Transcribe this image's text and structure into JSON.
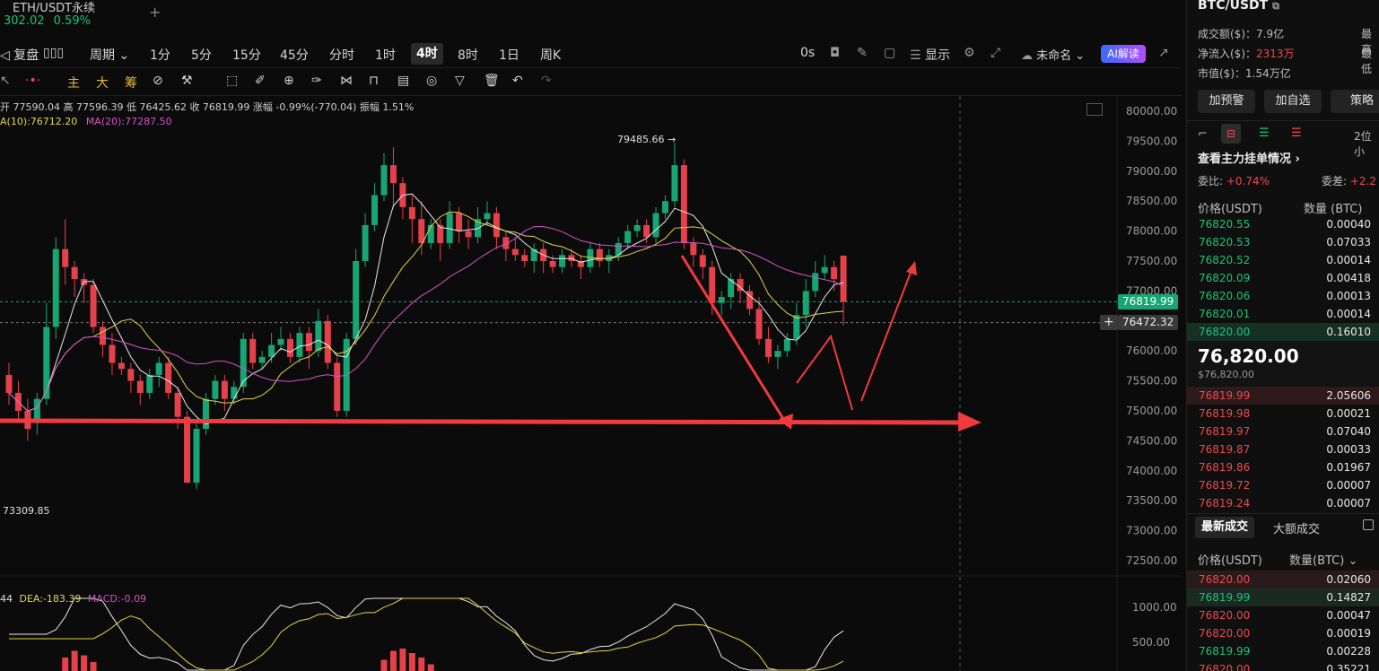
{
  "header": {
    "pair": "ETH/USDT永续",
    "price_partial": "302.02",
    "change": "0.59%",
    "add_tab": "+"
  },
  "toolbar": {
    "replay": "复盘",
    "period_label": "周期",
    "intervals": [
      "1分",
      "5分",
      "15分",
      "45分",
      "分时",
      "1时",
      "4时",
      "8时",
      "1日",
      "周K"
    ],
    "active_interval": "4时",
    "countdown": "0s",
    "display": "显示",
    "layout_name": "未命名",
    "ai_button": "AI解读"
  },
  "toolbar2": {
    "main": "主",
    "big": "大",
    "chip": "筹"
  },
  "chart_info": {
    "ohlc_line": "开 77590.04  高 77596.39  低 76425.62  收 76819.99  涨幅 -0.99%(-770.04)  振幅 1.51%",
    "ma10": "A(10):76712.20",
    "ma20": "MA(20):77287.50",
    "high_label": "79485.66 →",
    "low_label": "73309.85",
    "macd_dif": "44",
    "macd_dea": "DEA:-183.39",
    "macd_val": "MACD:-0.09"
  },
  "chart_data": {
    "type": "candlestick",
    "y_axis_ticks": [
      "80000.00",
      "79500.00",
      "79000.00",
      "78500.00",
      "78000.00",
      "77500.00",
      "77000.00",
      "76500.00",
      "76000.00",
      "75500.00",
      "75000.00",
      "74500.00",
      "74000.00",
      "73500.00",
      "73000.00",
      "72500.00"
    ],
    "macd_axis_ticks": [
      "1000.00",
      "500.00"
    ],
    "ylim": [
      72500,
      80000
    ],
    "last_price": "76819.99",
    "crosshair_price": "76472.32",
    "candles": [
      [
        75600,
        75300,
        75800,
        75100
      ],
      [
        75300,
        75000,
        75500,
        74800
      ],
      [
        75000,
        74700,
        75200,
        74500
      ],
      [
        74800,
        75200,
        75300,
        74600
      ],
      [
        75200,
        76400,
        76800,
        75100
      ],
      [
        76400,
        77700,
        77900,
        76200
      ],
      [
        77700,
        77400,
        78200,
        77100
      ],
      [
        77400,
        77200,
        77500,
        76900
      ],
      [
        77200,
        77100,
        77300,
        76800
      ],
      [
        77100,
        76400,
        77200,
        76300
      ],
      [
        76400,
        76100,
        76500,
        75900
      ],
      [
        76100,
        75800,
        76300,
        75600
      ],
      [
        75800,
        75700,
        75900,
        75600
      ],
      [
        75700,
        75500,
        75800,
        75300
      ],
      [
        75500,
        75300,
        75600,
        75100
      ],
      [
        75300,
        75600,
        75700,
        75200
      ],
      [
        75600,
        75800,
        75900,
        75400
      ],
      [
        75800,
        75300,
        75900,
        75200
      ],
      [
        75300,
        74900,
        75400,
        74700
      ],
      [
        74900,
        73800,
        75000,
        73800
      ],
      [
        73800,
        74700,
        74800,
        73700
      ],
      [
        74700,
        75200,
        75300,
        74600
      ],
      [
        75200,
        75500,
        75600,
        75100
      ],
      [
        75500,
        75200,
        75600,
        75000
      ],
      [
        75200,
        75400,
        75500,
        75100
      ],
      [
        75400,
        76200,
        76300,
        75300
      ],
      [
        76200,
        75800,
        76300,
        75700
      ],
      [
        75800,
        75900,
        76000,
        75700
      ],
      [
        75900,
        76100,
        76300,
        75800
      ],
      [
        76100,
        76200,
        76400,
        76000
      ],
      [
        76200,
        75900,
        76300,
        75800
      ],
      [
        75900,
        76300,
        76400,
        75800
      ],
      [
        76300,
        76000,
        76400,
        75700
      ],
      [
        76000,
        76500,
        76700,
        75900
      ],
      [
        76500,
        75800,
        76600,
        75700
      ],
      [
        75800,
        75000,
        75900,
        74900
      ],
      [
        75000,
        76200,
        76300,
        74900
      ],
      [
        76200,
        77500,
        77700,
        76100
      ],
      [
        77500,
        78100,
        78300,
        77400
      ],
      [
        78100,
        78600,
        78800,
        78000
      ],
      [
        78600,
        79100,
        79300,
        78500
      ],
      [
        79100,
        78800,
        79400,
        78400
      ],
      [
        78800,
        78400,
        78900,
        78200
      ],
      [
        78400,
        78200,
        78600,
        77800
      ],
      [
        78200,
        77800,
        78500,
        77600
      ],
      [
        77800,
        78100,
        78200,
        77700
      ],
      [
        78100,
        77800,
        78200,
        77500
      ],
      [
        77800,
        78300,
        78500,
        77700
      ],
      [
        78300,
        78000,
        78400,
        77800
      ],
      [
        78000,
        77900,
        78200,
        77700
      ],
      [
        77900,
        78200,
        78400,
        77800
      ],
      [
        78200,
        78300,
        78500,
        78100
      ],
      [
        78300,
        77900,
        78400,
        77700
      ],
      [
        77900,
        77700,
        78000,
        77500
      ],
      [
        77700,
        77600,
        77900,
        77500
      ],
      [
        77600,
        77500,
        77700,
        77400
      ],
      [
        77500,
        77700,
        77800,
        77300
      ],
      [
        77700,
        77500,
        77800,
        77300
      ],
      [
        77500,
        77400,
        77600,
        77300
      ],
      [
        77400,
        77600,
        77700,
        77300
      ],
      [
        77600,
        77500,
        77700,
        77400
      ],
      [
        77500,
        77400,
        77600,
        77200
      ],
      [
        77400,
        77700,
        77800,
        77300
      ],
      [
        77700,
        77500,
        77800,
        77400
      ],
      [
        77500,
        77600,
        77700,
        77300
      ],
      [
        77600,
        77800,
        77900,
        77500
      ],
      [
        77800,
        78000,
        78100,
        77700
      ],
      [
        78000,
        78100,
        78200,
        77900
      ],
      [
        78100,
        77900,
        78200,
        77800
      ],
      [
        77900,
        78300,
        78400,
        77800
      ],
      [
        78300,
        78500,
        78600,
        78200
      ],
      [
        78500,
        79100,
        79485.66,
        78400
      ],
      [
        79100,
        77800,
        79200,
        77700
      ],
      [
        77800,
        77600,
        77900,
        77400
      ],
      [
        77600,
        77400,
        77700,
        77200
      ],
      [
        77400,
        76800,
        77500,
        76600
      ],
      [
        76800,
        76900,
        77000,
        76600
      ],
      [
        76900,
        77200,
        77300,
        76700
      ],
      [
        77200,
        77000,
        77300,
        76800
      ],
      [
        77000,
        76700,
        77100,
        76600
      ],
      [
        76700,
        76200,
        76900,
        76100
      ],
      [
        76200,
        75900,
        76400,
        75800
      ],
      [
        75900,
        76000,
        76100,
        75700
      ],
      [
        76000,
        76200,
        76300,
        75900
      ],
      [
        76200,
        76600,
        76800,
        76100
      ],
      [
        76600,
        77000,
        77200,
        76400
      ],
      [
        77000,
        77300,
        77500,
        76900
      ],
      [
        77300,
        77400,
        77600,
        77200
      ],
      [
        77400,
        77200,
        77500,
        77000
      ],
      [
        77590.04,
        76819.99,
        77596.39,
        76425.62
      ]
    ]
  },
  "right_panel": {
    "pair": "BTC/USDT",
    "turnover_label": "成交额($)：",
    "turnover": "7.9亿",
    "inflow_label": "净流入($)：",
    "inflow": "2313万",
    "mcap_label": "市值($)：",
    "mcap": "1.54万亿",
    "high_label": "最高",
    "low_label": "最低",
    "buttons": [
      "加预警",
      "加自选",
      "策略"
    ],
    "precision": "2位小",
    "orderbook_title": "查看主力挂单情况",
    "ratio_label": "委比:",
    "ratio": "+0.74%",
    "diff_label": "委差:",
    "diff": "+2.2",
    "col_price": "价格(USDT)",
    "col_qty": "数量 (BTC)",
    "asks": [
      {
        "p": "76820.55",
        "q": "0.00040"
      },
      {
        "p": "76820.53",
        "q": "0.07033"
      },
      {
        "p": "76820.52",
        "q": "0.00014"
      },
      {
        "p": "76820.09",
        "q": "0.00418"
      },
      {
        "p": "76820.06",
        "q": "0.00013"
      },
      {
        "p": "76820.01",
        "q": "0.00014"
      },
      {
        "p": "76820.00",
        "q": "0.16010"
      }
    ],
    "last_price": "76,820.00",
    "last_price_usd": "$76,820.00",
    "bids": [
      {
        "p": "76819.99",
        "q": "2.05606"
      },
      {
        "p": "76819.98",
        "q": "0.00021"
      },
      {
        "p": "76819.97",
        "q": "0.07040"
      },
      {
        "p": "76819.87",
        "q": "0.00033"
      },
      {
        "p": "76819.86",
        "q": "0.01967"
      },
      {
        "p": "76819.72",
        "q": "0.00007"
      },
      {
        "p": "76819.24",
        "q": "0.00007"
      }
    ],
    "tab_latest": "最新成交",
    "tab_big": "大额成交",
    "trade_col_price": "价格(USDT)",
    "trade_col_qty": "数量(BTC)",
    "trades": [
      {
        "p": "76820.00",
        "q": "0.02060",
        "side": "red"
      },
      {
        "p": "76819.99",
        "q": "0.14827",
        "side": "green"
      },
      {
        "p": "76820.00",
        "q": "0.00047",
        "side": "red"
      },
      {
        "p": "76820.00",
        "q": "0.00019",
        "side": "red"
      },
      {
        "p": "76819.99",
        "q": "0.00228",
        "side": "green"
      },
      {
        "p": "76820.00",
        "q": "0.35221",
        "side": "red"
      }
    ]
  }
}
